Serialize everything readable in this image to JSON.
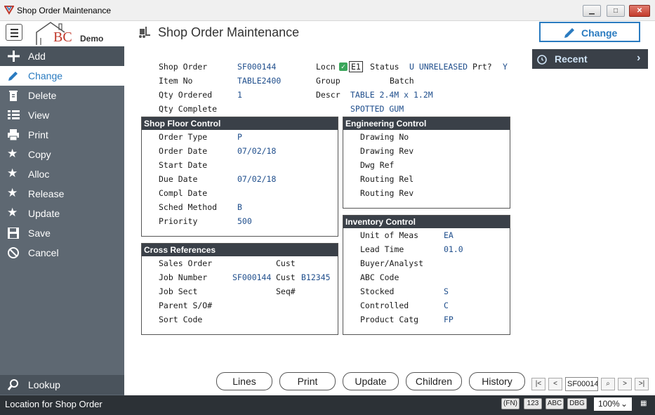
{
  "window": {
    "title": "Shop Order Maintenance"
  },
  "header": {
    "logo_text": "BC",
    "logo_suffix": "Demo",
    "page_title": "Shop Order Maintenance",
    "change_label": "Change"
  },
  "sidebar": {
    "items": [
      {
        "label": "Add",
        "icon": "plus-icon"
      },
      {
        "label": "Change",
        "icon": "pencil-icon"
      },
      {
        "label": "Delete",
        "icon": "trash-icon"
      },
      {
        "label": "View",
        "icon": "list-icon"
      },
      {
        "label": "Print",
        "icon": "printer-icon"
      },
      {
        "label": "Copy",
        "icon": "star-icon"
      },
      {
        "label": "Alloc",
        "icon": "star-icon"
      },
      {
        "label": "Release",
        "icon": "star-icon"
      },
      {
        "label": "Update",
        "icon": "star-icon"
      },
      {
        "label": "Save",
        "icon": "floppy-icon"
      },
      {
        "label": "Cancel",
        "icon": "cancel-icon"
      }
    ],
    "lookup_label": "Lookup"
  },
  "recent_label": "Recent",
  "order": {
    "shop_order_label": "Shop Order",
    "shop_order": "SF000144",
    "item_no_label": "Item No",
    "item_no": "TABLE2400",
    "qty_ordered_label": "Qty Ordered",
    "qty_ordered": "1",
    "qty_complete_label": "Qty Complete",
    "locn_label": "Locn",
    "locn": "E1",
    "status_label": "Status",
    "status": "U UNRELEASED",
    "prt_label": "Prt?",
    "prt": "Y",
    "group_label": "Group",
    "batch_label": "Batch",
    "descr_label": "Descr",
    "descr1": "TABLE 2.4M x 1.2M",
    "descr2": "SPOTTED GUM"
  },
  "shop_floor": {
    "title": "Shop Floor Control",
    "order_type_label": "Order Type",
    "order_type": "P",
    "order_date_label": "Order Date",
    "order_date": "07/02/18",
    "start_date_label": "Start Date",
    "due_date_label": "Due Date",
    "due_date": "07/02/18",
    "compl_date_label": "Compl Date",
    "sched_method_label": "Sched Method",
    "sched_method": "B",
    "priority_label": "Priority",
    "priority": "500"
  },
  "engineering": {
    "title": "Engineering Control",
    "drawing_no_label": "Drawing No",
    "drawing_rev_label": "Drawing Rev",
    "dwg_ref_label": "Dwg Ref",
    "routing_rel_label": "Routing Rel",
    "routing_rev_label": "Routing Rev"
  },
  "cross_refs": {
    "title": "Cross References",
    "sales_order_label": "Sales Order",
    "cust_label1": "Cust",
    "job_number_label": "Job Number",
    "job_number": "SF000144",
    "cust_label2": "Cust",
    "cust": "B12345",
    "job_sect_label": "Job Sect",
    "seq_label": "Seq#",
    "parent_label": "Parent S/O#",
    "sort_code_label": "Sort Code"
  },
  "inventory": {
    "title": "Inventory Control",
    "uom_label": "Unit of Meas",
    "uom": "EA",
    "lead_time_label": "Lead Time",
    "lead_time": "01.0",
    "buyer_label": "Buyer/Analyst",
    "abc_label": "ABC Code",
    "stocked_label": "Stocked",
    "stocked": "S",
    "controlled_label": "Controlled",
    "controlled": "C",
    "product_catg_label": "Product Catg",
    "product_catg": "FP"
  },
  "bottom_buttons": [
    "Lines",
    "Print",
    "Update",
    "Children",
    "History"
  ],
  "navigator": {
    "current": "SF00014"
  },
  "status": {
    "message": "Location for Shop Order",
    "chips": [
      "(FN)",
      "123",
      "ABC",
      "DBG"
    ],
    "zoom": "100%"
  },
  "colors": {
    "accent": "#2a7bc0",
    "sidebar": "#5e6872",
    "panel_header": "#3a4048",
    "value_text": "#1f4e8c"
  }
}
